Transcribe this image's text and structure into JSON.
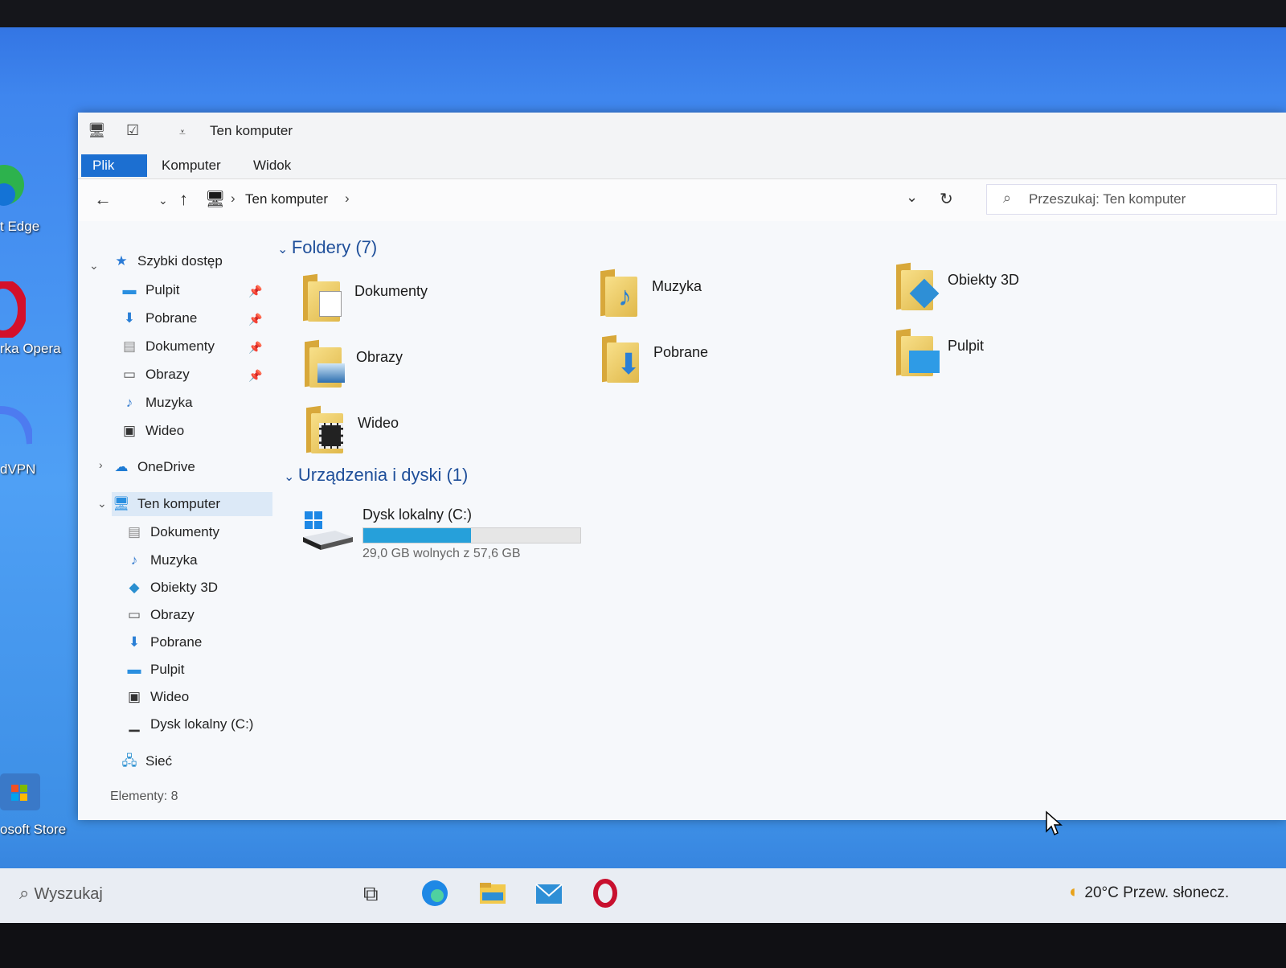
{
  "desktop": {
    "icons": [
      {
        "label": "t Edge"
      },
      {
        "label": "rka Opera"
      },
      {
        "label": "dVPN"
      },
      {
        "label": "osoft Store"
      }
    ]
  },
  "window": {
    "title": "Ten komputer",
    "ribbon_tabs": [
      "Plik",
      "Komputer",
      "Widok"
    ],
    "breadcrumb": "Ten komputer",
    "search_placeholder": "Przeszukaj: Ten komputer"
  },
  "navpane": {
    "quick_access": "Szybki dostęp",
    "quick_items": [
      "Pulpit",
      "Pobrane",
      "Dokumenty",
      "Obrazy",
      "Muzyka",
      "Wideo"
    ],
    "onedrive": "OneDrive",
    "this_pc": "Ten komputer",
    "pc_items": [
      "Dokumenty",
      "Muzyka",
      "Obiekty 3D",
      "Obrazy",
      "Pobrane",
      "Pulpit",
      "Wideo",
      "Dysk lokalny (C:)"
    ],
    "network": "Sieć"
  },
  "content": {
    "folders_header": "Foldery (7)",
    "folders": [
      "Dokumenty",
      "Muzyka",
      "Obiekty 3D",
      "Obrazy",
      "Pobrane",
      "Pulpit",
      "Wideo"
    ],
    "devices_header": "Urządzenia i dyski (1)",
    "drive": {
      "name": "Dysk lokalny (C:)",
      "free_text": "29,0 GB wolnych z 57,6 GB",
      "used_fraction": 0.497
    }
  },
  "status": "Elementy: 8",
  "taskbar": {
    "search_label": "Wyszukaj",
    "weather": "20°C  Przew. słonecz."
  },
  "colors": {
    "accent": "#1c6fd1",
    "drive_fill": "#26a0da"
  }
}
